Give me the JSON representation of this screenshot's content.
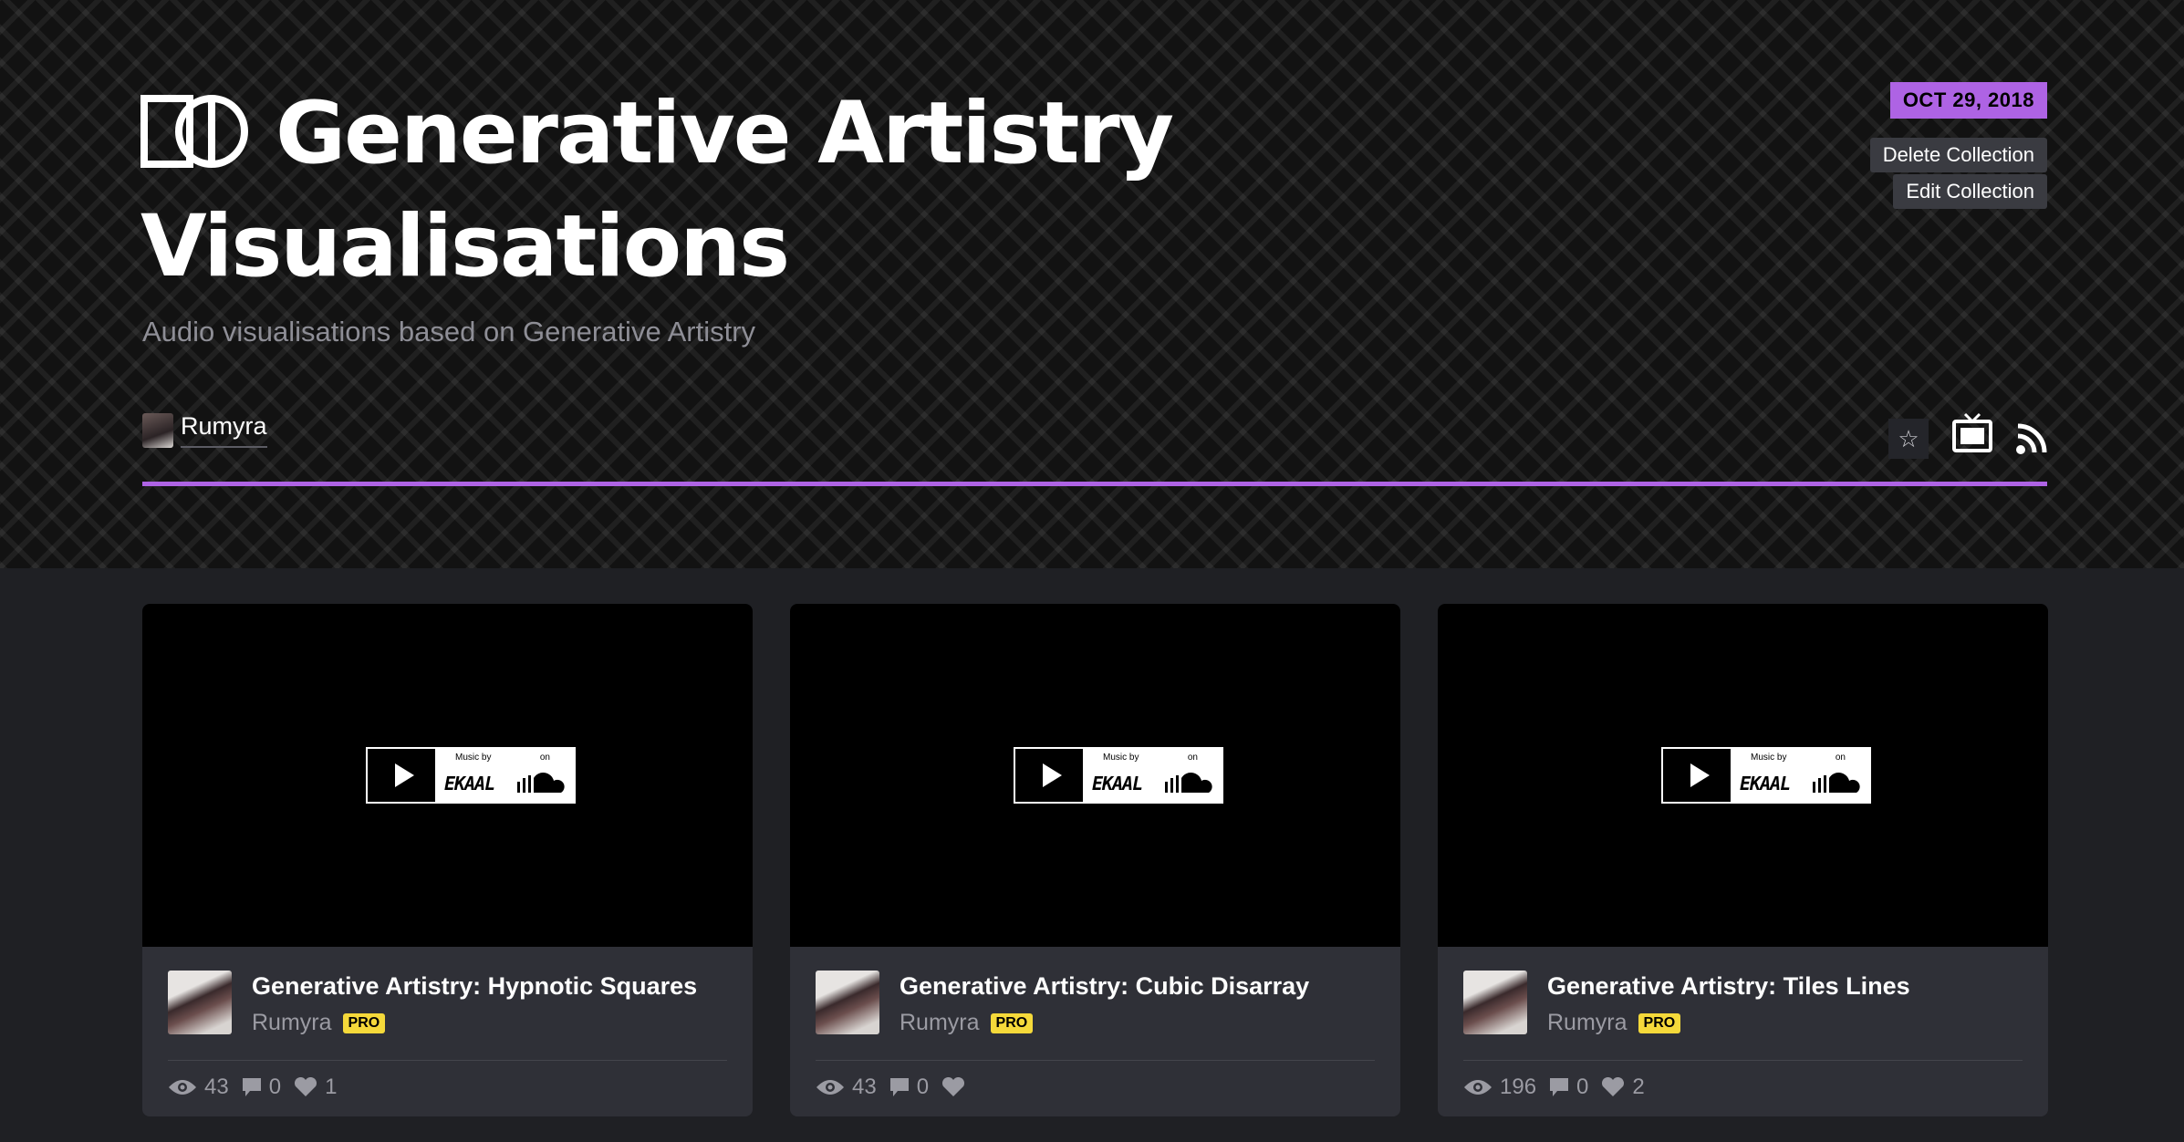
{
  "collection": {
    "title_line1": "Generative Artistry",
    "title_line2": "Visualisations",
    "description": "Audio visualisations based on Generative Artistry",
    "author": "Rumyra",
    "date": "OCT 29, 2018",
    "delete_label": "Delete Collection",
    "edit_label": "Edit Collection",
    "accent_color": "#ae63e4"
  },
  "icons": {
    "logo": "codepen-collection-icon",
    "star": "star-icon",
    "presentation": "tv-icon",
    "feed": "rss-icon"
  },
  "star_glyph": "☆",
  "player": {
    "music_by": "Music by",
    "on": "on",
    "artist": "EKAAL"
  },
  "pens": [
    {
      "title": "Generative Artistry: Hypnotic Squares",
      "user": "Rumyra",
      "badge": "PRO",
      "views": "43",
      "comments": "0",
      "likes": "1"
    },
    {
      "title": "Generative Artistry: Cubic Disarray",
      "user": "Rumyra",
      "badge": "PRO",
      "views": "43",
      "comments": "0",
      "likes": ""
    },
    {
      "title": "Generative Artistry: Tiles Lines",
      "user": "Rumyra",
      "badge": "PRO",
      "views": "196",
      "comments": "0",
      "likes": "2"
    }
  ]
}
